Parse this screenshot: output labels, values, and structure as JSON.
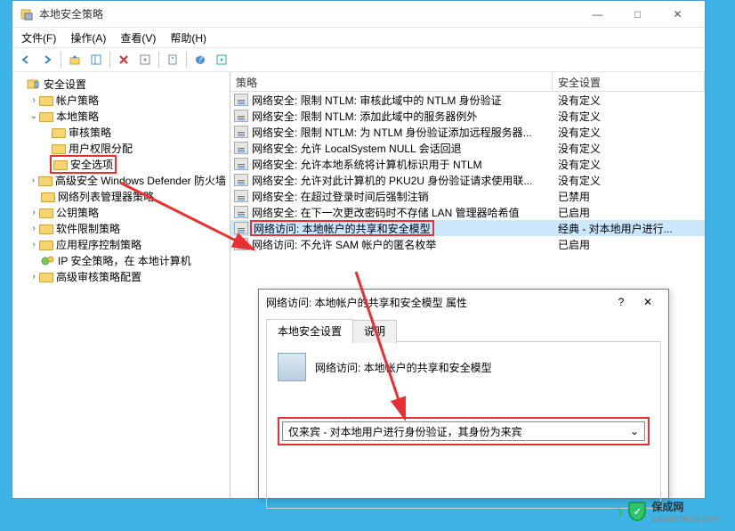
{
  "window": {
    "title": "本地安全策略",
    "controls": {
      "min": "—",
      "max": "□",
      "close": "✕"
    }
  },
  "menu": {
    "file": "文件(F)",
    "action": "操作(A)",
    "view": "查看(V)",
    "help": "帮助(H)"
  },
  "tree": {
    "root": "安全设置",
    "n1": "帐户策略",
    "n2": "本地策略",
    "n2a": "审核策略",
    "n2b": "用户权限分配",
    "n2c": "安全选项",
    "n3": "高级安全 Windows Defender 防火墙",
    "n4": "网络列表管理器策略",
    "n5": "公钥策略",
    "n6": "软件限制策略",
    "n7": "应用程序控制策略",
    "n8": "IP 安全策略，在 本地计算机",
    "n9": "高级审核策略配置"
  },
  "list": {
    "col1": "策略",
    "col2": "安全设置",
    "rows": [
      {
        "p": "网络安全: 限制 NTLM: 审核此域中的 NTLM 身份验证",
        "v": "没有定义"
      },
      {
        "p": "网络安全: 限制 NTLM: 添加此域中的服务器例外",
        "v": "没有定义"
      },
      {
        "p": "网络安全: 限制 NTLM: 为 NTLM 身份验证添加远程服务器...",
        "v": "没有定义"
      },
      {
        "p": "网络安全: 允许 LocalSystem NULL 会话回退",
        "v": "没有定义"
      },
      {
        "p": "网络安全: 允许本地系统将计算机标识用于 NTLM",
        "v": "没有定义"
      },
      {
        "p": "网络安全: 允许对此计算机的 PKU2U 身份验证请求使用联...",
        "v": "没有定义"
      },
      {
        "p": "网络安全: 在超过登录时间后强制注销",
        "v": "已禁用"
      },
      {
        "p": "网络安全: 在下一次更改密码时不存储 LAN 管理器哈希值",
        "v": "已启用"
      },
      {
        "p": "网络访问: 本地帐户的共享和安全模型",
        "v": "经典 - 对本地用户进行..."
      },
      {
        "p": "网络访问: 不允许 SAM 帐户的匿名枚举",
        "v": "已启用"
      }
    ]
  },
  "dialog": {
    "title": "网络访问: 本地帐户的共享和安全模型 属性",
    "help": "?",
    "close": "✕",
    "tab1": "本地安全设置",
    "tab2": "说明",
    "label": "网络访问: 本地帐户的共享和安全模型",
    "value": "仅来宾 - 对本地用户进行身份验证，其身份为来宾"
  },
  "watermark": {
    "brand": "保成网",
    "url": "zsbaocheng.com"
  }
}
